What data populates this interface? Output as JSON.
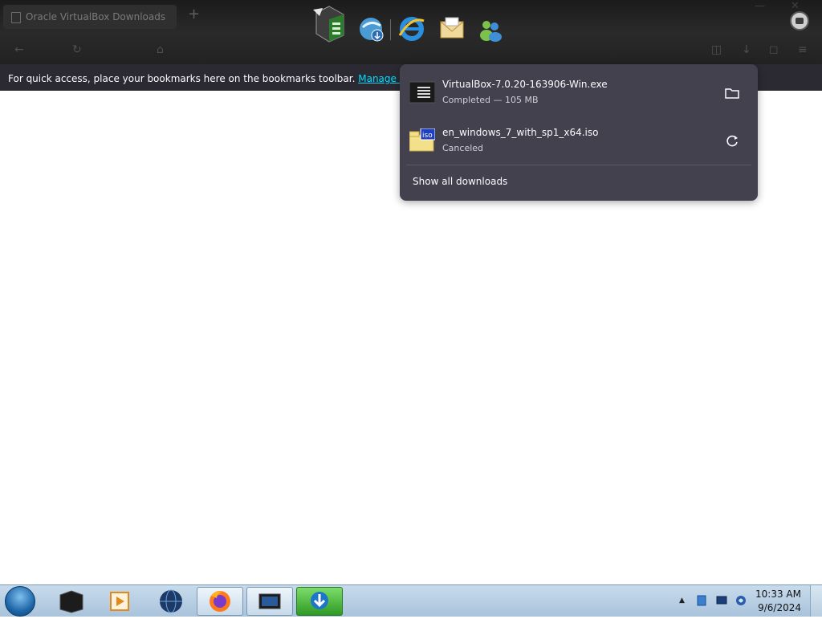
{
  "browser": {
    "tab_title": "Oracle VirtualBox Downloads",
    "new_tab_label": "+",
    "bookmarks_bar_text": "For quick access, place your bookmarks here on the bookmarks toolbar.",
    "bookmarks_link": "Manage bookmarks..."
  },
  "dock": {
    "icons": [
      "window-manager-icon",
      "ie-download-icon",
      "internet-explorer-icon",
      "mail-icon",
      "messenger-icon"
    ]
  },
  "downloads": {
    "items": [
      {
        "name": "VirtualBox-7.0.20-163906-Win.exe",
        "status": "Completed — 105 MB",
        "action_icon": "folder-icon"
      },
      {
        "name": "en_windows_7_with_sp1_x64.iso",
        "status": "Canceled",
        "action_icon": "retry-icon"
      }
    ],
    "show_all": "Show all downloads"
  },
  "taskbar": {
    "time": "10:33 AM",
    "date": "9/6/2024",
    "tray_arrow": "▲"
  },
  "colors": {
    "panel_bg": "#42414d",
    "link": "#00ddff",
    "taskbar": "#b8cde0"
  }
}
